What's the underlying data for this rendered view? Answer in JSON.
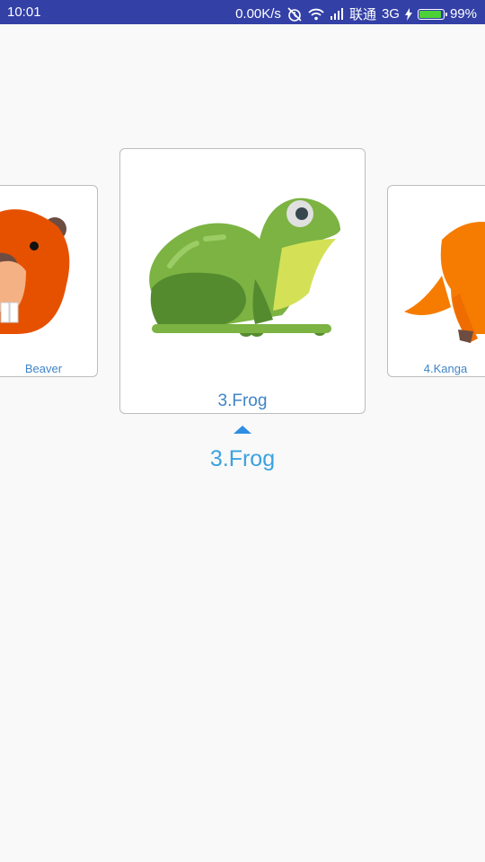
{
  "status_bar": {
    "time": "10:01",
    "net_speed": "0.00K/s",
    "carrier": "联通",
    "network_type": "3G",
    "battery": "99%",
    "battery_level": 0.99,
    "colors": {
      "bar": "#3340a6",
      "battery_fill": "#4cd137"
    }
  },
  "carousel": {
    "items": [
      {
        "label": "Beaver",
        "icon": "beaver-icon",
        "color": "#e65100"
      },
      {
        "label": "3.Frog",
        "icon": "frog-icon",
        "color": "#7cb342"
      },
      {
        "label": "4.Kanga",
        "icon": "kangaroo-icon",
        "color": "#f57c00"
      }
    ]
  },
  "selected": {
    "label": "3.Frog",
    "color": "#3aa2e0"
  }
}
